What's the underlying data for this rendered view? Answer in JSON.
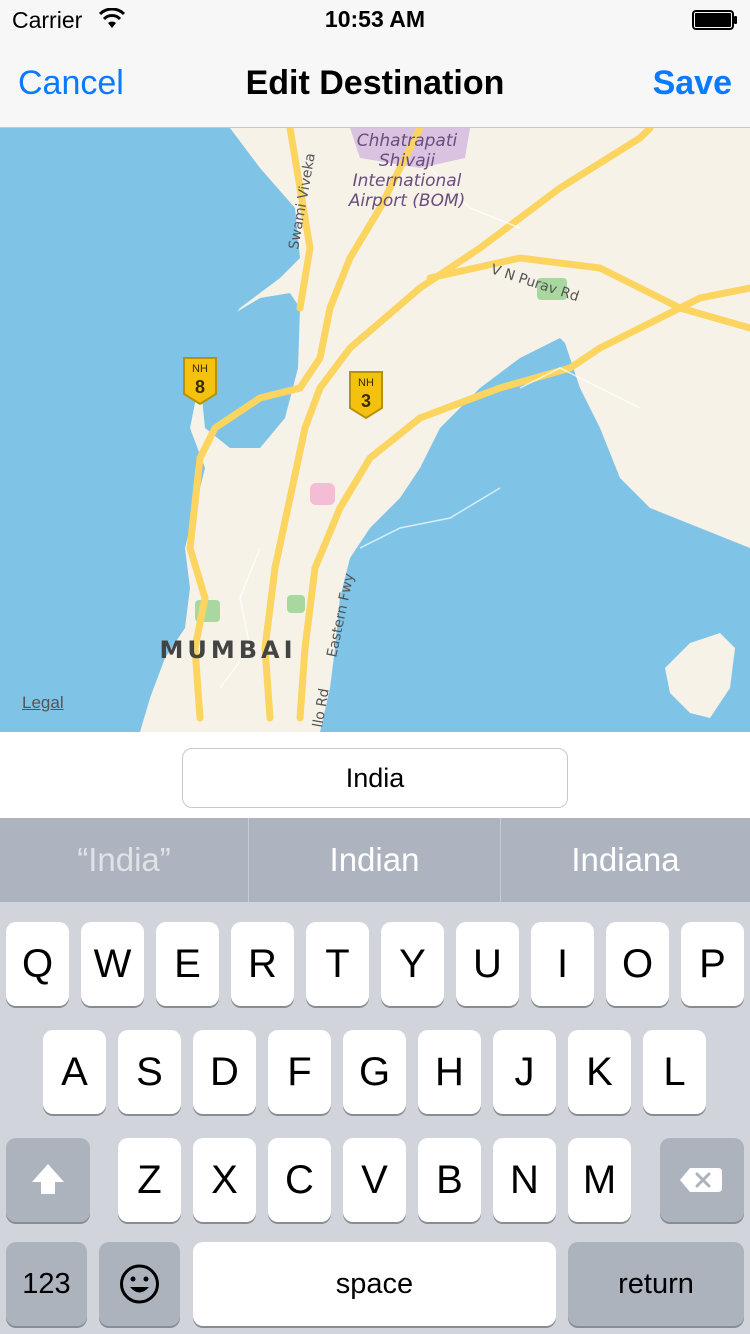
{
  "status_bar": {
    "carrier": "Carrier",
    "time": "10:53 AM"
  },
  "nav": {
    "cancel_label": "Cancel",
    "title": "Edit Destination",
    "save_label": "Save"
  },
  "map": {
    "labels": {
      "airport": [
        "Chhatrapati",
        "Shivaji",
        "International",
        "Airport (BOM)"
      ],
      "city": "MUMBAI",
      "swami": "Swami Viveka",
      "vn_purav": "V N Purav Rd",
      "eastern_fwy": "Eastern Fwy",
      "lo_rd": "llo Rd",
      "nh8_top": "NH",
      "nh8_num": "8",
      "nh3_top": "NH",
      "nh3_num": "3"
    },
    "legal": "Legal",
    "colors": {
      "water": "#7fc3e6",
      "land": "#f6f2e8",
      "road": "#fbd560",
      "park": "#a8d8a0",
      "airport": "#d9c3e0"
    }
  },
  "destination_input": {
    "value": "India"
  },
  "suggestions": [
    "“India”",
    "Indian",
    "Indiana"
  ],
  "keyboard": {
    "row1": [
      "Q",
      "W",
      "E",
      "R",
      "T",
      "Y",
      "U",
      "I",
      "O",
      "P"
    ],
    "row2": [
      "A",
      "S",
      "D",
      "F",
      "G",
      "H",
      "J",
      "K",
      "L"
    ],
    "row3": [
      "Z",
      "X",
      "C",
      "V",
      "B",
      "N",
      "M"
    ],
    "numbers_key": "123",
    "emoji_icon": "emoji-icon",
    "space_label": "space",
    "return_label": "return",
    "shift_icon": "shift-icon",
    "delete_icon": "delete-icon"
  }
}
